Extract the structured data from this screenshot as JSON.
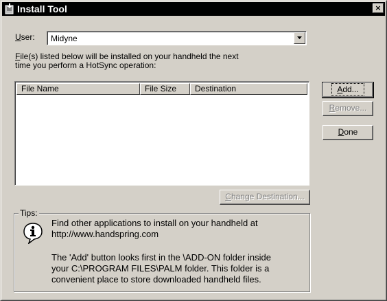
{
  "window": {
    "title": "Install Tool",
    "close_glyph": "×"
  },
  "user": {
    "label_accel": "U",
    "label_rest": "ser:",
    "value": "Midyne"
  },
  "description": {
    "line1_accel": "F",
    "line1_rest": "ile(s) listed below will be installed on your handheld the next",
    "line2": "time you perform a HotSync operation:"
  },
  "file_list": {
    "columns": [
      "File Name",
      "File Size",
      "Destination"
    ],
    "rows": []
  },
  "buttons": {
    "add_accel": "A",
    "add_rest": "dd...",
    "remove_accel": "R",
    "remove_rest": "emove...",
    "done_accel": "D",
    "done_rest": "one",
    "change_destination_accel": "C",
    "change_destination_rest": "hange Destination..."
  },
  "tips": {
    "legend": "Tips:",
    "tip1_line1": "Find other applications to install on your handheld at",
    "tip1_line2": "http://www.handspring.com",
    "tip2_line1": "The 'Add' button looks first in the \\ADD-ON folder inside",
    "tip2_line2": "your C:\\PROGRAM FILES\\PALM folder. This folder is a",
    "tip2_line3": "convenient place to store downloaded handheld files."
  },
  "icons": {
    "app": "palm-install-icon",
    "info": "info-icon",
    "dropdown": "chevron-down-icon"
  }
}
